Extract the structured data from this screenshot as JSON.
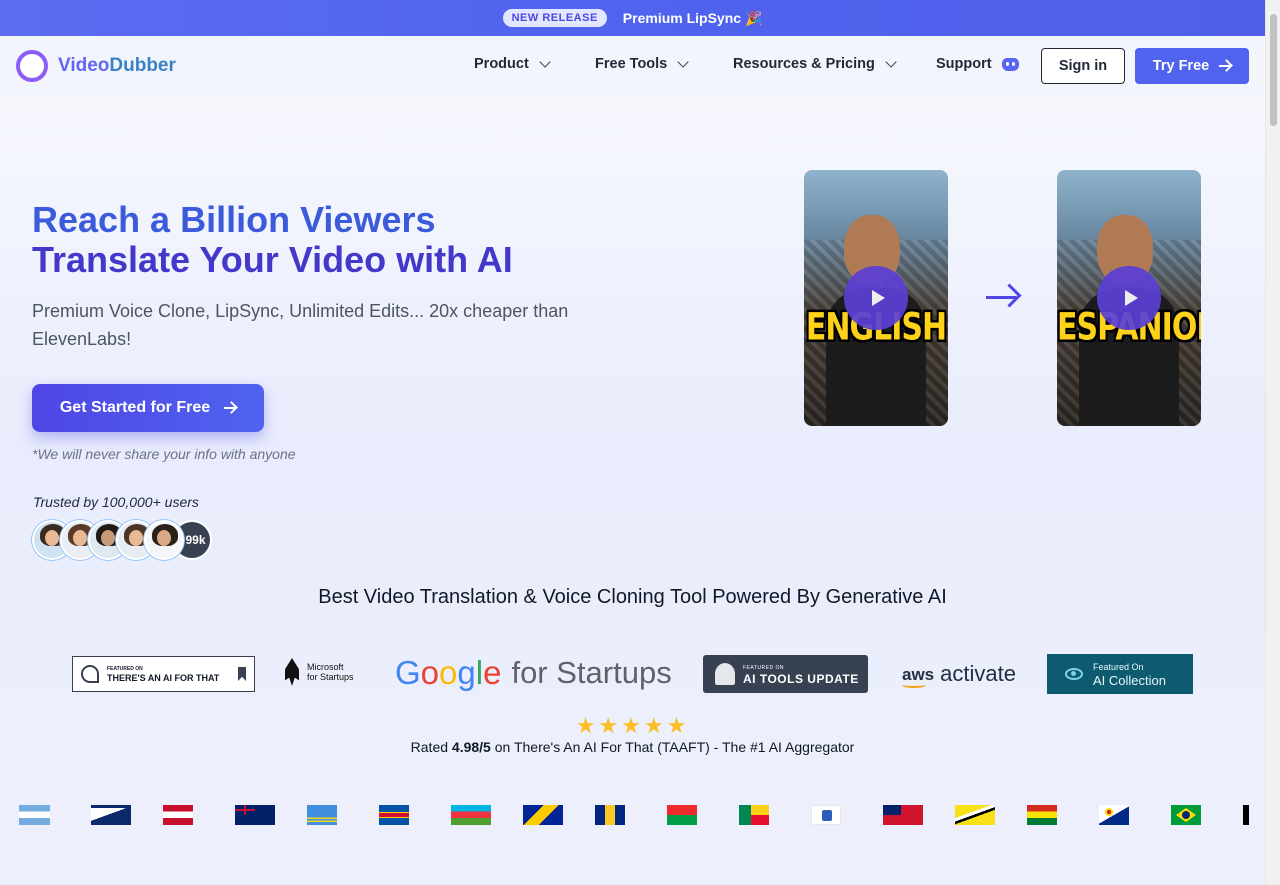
{
  "announcement": {
    "badge": "NEW RELEASE",
    "text": "Premium LipSync 🎉"
  },
  "brand": {
    "word_part1": "Video",
    "word_part2": "Dubber"
  },
  "nav": {
    "items": [
      {
        "label": "Product",
        "icon": "chevron-down-icon"
      },
      {
        "label": "Free Tools",
        "icon": "chevron-down-icon"
      },
      {
        "label": "Resources & Pricing",
        "icon": "chevron-down-icon"
      },
      {
        "label": "Support",
        "icon": "discord-icon"
      }
    ],
    "signin": "Sign in",
    "try_free": "Try Free"
  },
  "hero": {
    "headline_line1": "Reach a Billion Viewers",
    "headline_line2": "Translate Your Video with AI",
    "subtitle": "Premium Voice Clone, LipSync, Unlimited Edits... 20x cheaper than ElevenLabs!",
    "cta": "Get Started for Free",
    "note": "*We will never share your info with anyone",
    "trusted": "Trusted by 100,000+ users",
    "more_users": "+99k"
  },
  "videos": [
    {
      "caption": "ENGLISH"
    },
    {
      "caption": "ESPANIOL"
    }
  ],
  "section": {
    "title": "Best Video Translation & Voice Cloning Tool Powered By Generative AI"
  },
  "logos": {
    "taaft_small": "FEATURED ON",
    "taaft": "THERE'S AN AI FOR THAT",
    "microsoft_line1": "Microsoft",
    "microsoft_line2": "for Startups",
    "google_for_startups": "for Startups",
    "aitu_small": "FEATURED ON",
    "aitu": "AI TOOLS UPDATE",
    "aws": "aws",
    "aws_activate": "activate",
    "aic_small": "Featured On",
    "aic": "AI Collection"
  },
  "rating": {
    "stars": "★★★★★",
    "prefix": "Rated",
    "score": "4.98/5",
    "suffix": "on There's An AI For That (TAAFT) - The #1 AI Aggregator"
  },
  "colors": {
    "accent": "#4f63ef",
    "headline_blue": "#3b5bdb",
    "headline_indigo": "#4338ca",
    "star": "#fbbf24"
  },
  "flags": [
    "argentina",
    "american-samoa",
    "austria",
    "australia",
    "aruba",
    "aland-islands",
    "azerbaijan",
    "bosnia",
    "barbados",
    "burkina-faso",
    "benin",
    "saint-barthelemy",
    "bermuda",
    "brunei",
    "bolivia",
    "bonaire",
    "brazil",
    "bahamas"
  ]
}
